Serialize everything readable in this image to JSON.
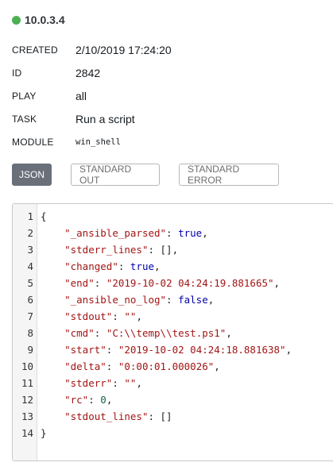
{
  "host": {
    "name": "10.0.3.4",
    "status_color": "#4caf50",
    "status_icon": "status-ok-dot"
  },
  "details": [
    {
      "label": "CREATED",
      "value": "2/10/2019 17:24:20"
    },
    {
      "label": "ID",
      "value": "2842"
    },
    {
      "label": "PLAY",
      "value": "all"
    },
    {
      "label": "TASK",
      "value": "Run a script"
    },
    {
      "label": "MODULE",
      "value": "win_shell"
    }
  ],
  "tabs": [
    {
      "label": "JSON",
      "active": true
    },
    {
      "label": "STANDARD OUT",
      "active": false
    },
    {
      "label": "STANDARD ERROR",
      "active": false
    }
  ],
  "code": {
    "open": "{",
    "close": "}",
    "entries": [
      {
        "key": "\"_ansible_parsed\"",
        "value": "true",
        "type": "bool"
      },
      {
        "key": "\"stderr_lines\"",
        "value": "[]",
        "type": "punct"
      },
      {
        "key": "\"changed\"",
        "value": "true",
        "type": "bool"
      },
      {
        "key": "\"end\"",
        "value": "\"2019-10-02 04:24:19.881665\"",
        "type": "string"
      },
      {
        "key": "\"_ansible_no_log\"",
        "value": "false",
        "type": "bool"
      },
      {
        "key": "\"stdout\"",
        "value": "\"\"",
        "type": "string"
      },
      {
        "key": "\"cmd\"",
        "value": "\"C:\\\\temp\\\\test.ps1\"",
        "type": "string"
      },
      {
        "key": "\"start\"",
        "value": "\"2019-10-02 04:24:18.881638\"",
        "type": "string"
      },
      {
        "key": "\"delta\"",
        "value": "\"0:00:01.000026\"",
        "type": "string"
      },
      {
        "key": "\"stderr\"",
        "value": "\"\"",
        "type": "string"
      },
      {
        "key": "\"rc\"",
        "value": "0",
        "type": "number"
      },
      {
        "key": "\"stdout_lines\"",
        "value": "[]",
        "type": "punct"
      }
    ],
    "line_numbers": [
      "1",
      "2",
      "3",
      "4",
      "5",
      "6",
      "7",
      "8",
      "9",
      "10",
      "11",
      "12",
      "13",
      "14"
    ]
  }
}
